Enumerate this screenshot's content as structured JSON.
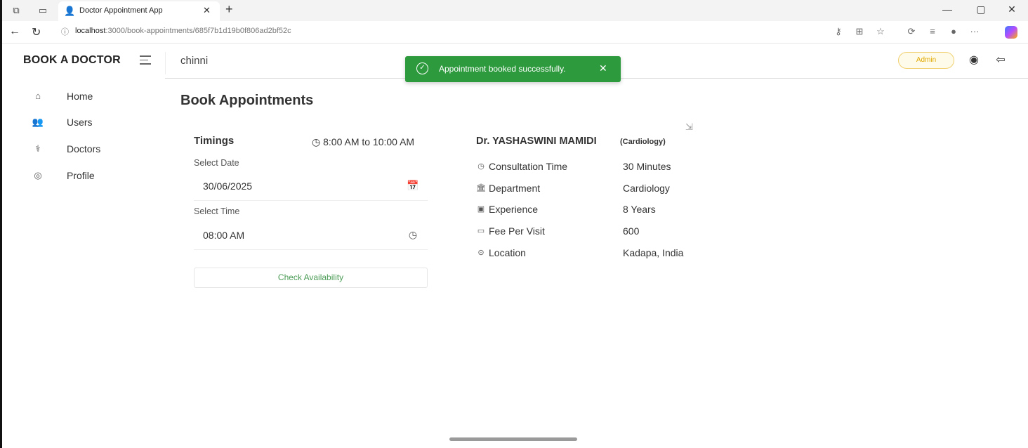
{
  "browser": {
    "tab_title": "Doctor Appointment App",
    "url_host": "localhost",
    "url_rest": ":3000/book-appointments/685f7b1d19b0f806ad2bf52c"
  },
  "header": {
    "brand": "BOOK A DOCTOR",
    "username": "chinni",
    "role_badge": "Admin"
  },
  "toast": {
    "message": "Appointment booked successfully.",
    "color": "#2e9a3e"
  },
  "sidebar": {
    "items": [
      {
        "label": "Home",
        "icon": "home-icon"
      },
      {
        "label": "Users",
        "icon": "users-icon"
      },
      {
        "label": "Doctors",
        "icon": "doctor-icon"
      },
      {
        "label": "Profile",
        "icon": "profile-icon"
      }
    ]
  },
  "main": {
    "title": "Book Appointments",
    "timings_label": "Timings",
    "timings_value": "8:00 AM to 10:00 AM",
    "date_label": "Select Date",
    "date_value": "30/06/2025",
    "time_label": "Select Time",
    "time_value": "08:00 AM",
    "check_button": "Check Availability"
  },
  "doctor": {
    "name": "Dr. YASHASWINI MAMIDI",
    "specialization": "(Cardiology)",
    "details": [
      {
        "key": "Consultation Time",
        "value": "30 Minutes",
        "icon": "clock-icon"
      },
      {
        "key": "Department",
        "value": "Cardiology",
        "icon": "building-icon"
      },
      {
        "key": "Experience",
        "value": "8 Years",
        "icon": "badge-icon"
      },
      {
        "key": "Fee Per Visit",
        "value": "600",
        "icon": "money-icon"
      },
      {
        "key": "Location",
        "value": "Kadapa, India",
        "icon": "location-icon"
      }
    ]
  },
  "colors": {
    "accent_green": "#4a9b55",
    "admin_badge": "#e0a800"
  }
}
